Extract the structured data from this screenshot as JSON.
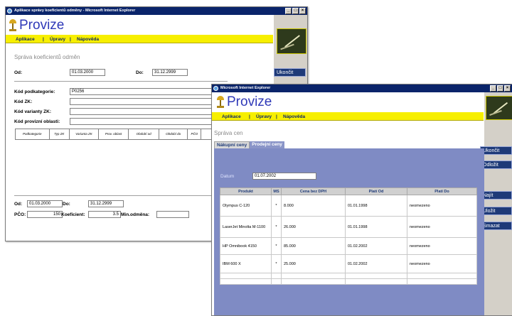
{
  "window1": {
    "title": "Aplikace správy koeficientů odměny - Microsoft Internet Explorer",
    "logo": "Provize",
    "menu": [
      "Aplikace",
      "|",
      "Úpravy",
      "|",
      "Nápověda"
    ],
    "heading": "Správa koeficientů odměn",
    "od_label": "Od:",
    "od_value": "01.03.2000",
    "do_label": "Do:",
    "do_value": "31.12.2999",
    "fields": [
      {
        "label": "Kód podkategorie:",
        "value": "P0256"
      },
      {
        "label": "Kód ZK:",
        "value": ""
      },
      {
        "label": "Kód varianty ZK:",
        "value": ""
      },
      {
        "label": "Kód provizní oblasti:",
        "value": ""
      }
    ],
    "table_columns": [
      "Podkategorie",
      "Typ ZK",
      "Varianta ZK",
      "Prov. oblast",
      "Období od",
      "Období do",
      "PČO",
      "Ko"
    ],
    "bottom": {
      "od_label": "Od:",
      "od_value": "01.03.2000",
      "do_label": "Do:",
      "do_value": "31.12.2999",
      "pco_label": "PČO:",
      "pco_value": "150",
      "koef_label": "Koeficient:",
      "koef_value": "3.5",
      "minodm_label": "Min.odměna:",
      "minodm_value": ""
    },
    "side_buttons": [
      "Ukončit"
    ]
  },
  "window2": {
    "title": "Microsoft Internet Explorer",
    "logo": "Provize",
    "menu": [
      "Aplikace",
      "|",
      "Úpravy",
      "|",
      "Nápověda"
    ],
    "heading": "Správa cen",
    "tabs": [
      "Nákupní ceny",
      "Prodejní ceny"
    ],
    "datum_label": "Datum",
    "datum_value": "01.07.2002",
    "columns": [
      "Produkt",
      "MS",
      "Cena bez DPH",
      "Platí Od",
      "Platí Do"
    ],
    "rows": [
      {
        "produkt": "Olympus C-120",
        "ms": "*",
        "cena": "8.000",
        "od": "01.01.1998",
        "do": "neomezeno"
      },
      {
        "produkt": "LaserJet Minolta M-1100",
        "ms": "*",
        "cena": "26.000",
        "od": "01.01.1998",
        "do": "neomezeno"
      },
      {
        "produkt": "HP Omnibook 4150",
        "ms": "*",
        "cena": "85.000",
        "od": "01.02.2002",
        "do": "neomezeno"
      },
      {
        "produkt": "IBM 600 X",
        "ms": "*",
        "cena": "25.000",
        "od": "01.02.2002",
        "do": "neomezeno"
      }
    ],
    "side_buttons": [
      "Ukončit",
      "Odložit",
      "Najít",
      "Uložit",
      "Smazat"
    ]
  },
  "colors": {
    "menubar": "#f7ef00",
    "titlebar": "#0a246a",
    "logo_text": "#2f39b8",
    "panel_blue": "#7f8bc4",
    "side_button": "#1e3a78"
  }
}
